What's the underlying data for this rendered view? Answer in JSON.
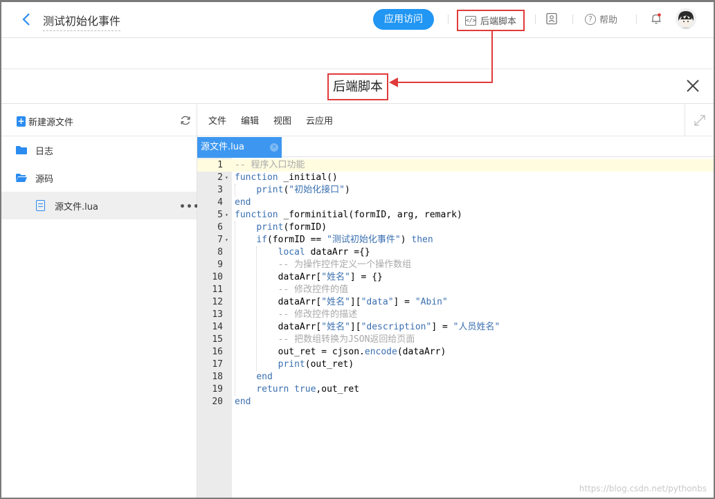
{
  "topbar": {
    "title": "测试初始化事件",
    "app_visit": "应用访问",
    "backend_script": "后端脚本",
    "help": "帮助"
  },
  "annotation": {
    "callout": "后端脚本"
  },
  "sidebar": {
    "new_file": "新建源文件",
    "items": [
      {
        "label": "日志",
        "icon": "folder-icon"
      },
      {
        "label": "源码",
        "icon": "folder-open-icon"
      },
      {
        "label": "源文件.lua",
        "icon": "document-icon"
      }
    ]
  },
  "editor": {
    "menu": [
      "文件",
      "编辑",
      "视图",
      "云应用"
    ],
    "tab": "源文件.lua",
    "lines": [
      {
        "n": "1",
        "fold": "",
        "code": "-- 程序入口功能"
      },
      {
        "n": "2",
        "fold": "▾",
        "code": "function _initial()"
      },
      {
        "n": "3",
        "fold": "",
        "code": "    print(\"初始化接口\")"
      },
      {
        "n": "4",
        "fold": "",
        "code": "end"
      },
      {
        "n": "5",
        "fold": "▾",
        "code": "function _forminitial(formID, arg, remark)"
      },
      {
        "n": "6",
        "fold": "",
        "code": "    print(formID)"
      },
      {
        "n": "7",
        "fold": "▾",
        "code": "    if(formID == \"测试初始化事件\") then"
      },
      {
        "n": "8",
        "fold": "",
        "code": "        local dataArr ={}"
      },
      {
        "n": "9",
        "fold": "",
        "code": "        -- 为操作控件定义一个操作数组"
      },
      {
        "n": "10",
        "fold": "",
        "code": "        dataArr[\"姓名\"] = {}"
      },
      {
        "n": "11",
        "fold": "",
        "code": "        -- 修改控件的值"
      },
      {
        "n": "12",
        "fold": "",
        "code": "        dataArr[\"姓名\"][\"data\"] = \"Abin\""
      },
      {
        "n": "13",
        "fold": "",
        "code": "        -- 修改控件的描述"
      },
      {
        "n": "14",
        "fold": "",
        "code": "        dataArr[\"姓名\"][\"description\"] = \"人员姓名\""
      },
      {
        "n": "15",
        "fold": "",
        "code": "        -- 把数组转换为JSON返回给页面"
      },
      {
        "n": "16",
        "fold": "",
        "code": "        out_ret = cjson.encode(dataArr)"
      },
      {
        "n": "17",
        "fold": "",
        "code": "        print(out_ret)"
      },
      {
        "n": "18",
        "fold": "",
        "code": "    end"
      },
      {
        "n": "19",
        "fold": "",
        "code": "    return true,out_ret"
      },
      {
        "n": "20",
        "fold": "",
        "code": "end"
      }
    ]
  },
  "watermark": "https://blog.csdn.net/pythonbs",
  "colors": {
    "accent": "#2196f3",
    "annotation": "#e03a3a",
    "tab": "#3d97f0"
  }
}
